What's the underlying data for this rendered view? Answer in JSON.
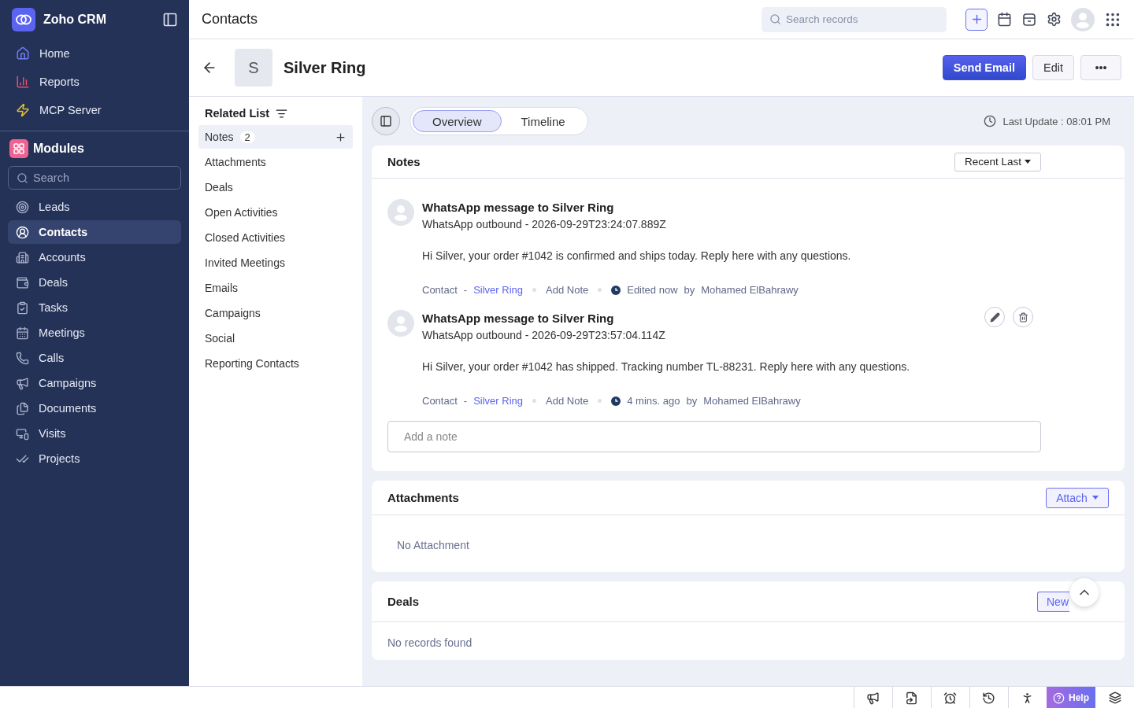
{
  "brand": {
    "name": "Zoho CRM"
  },
  "top_nav": [
    {
      "label": "Home",
      "kind": "home"
    },
    {
      "label": "Reports",
      "kind": "reports"
    },
    {
      "label": "MCP Server",
      "kind": "mcp"
    }
  ],
  "modules": {
    "title": "Modules",
    "search_placeholder": "Search",
    "items": [
      {
        "label": "Leads",
        "kind": "leads",
        "selected": false
      },
      {
        "label": "Contacts",
        "kind": "contacts",
        "selected": true
      },
      {
        "label": "Accounts",
        "kind": "accounts",
        "selected": false
      },
      {
        "label": "Deals",
        "kind": "deals",
        "selected": false
      },
      {
        "label": "Tasks",
        "kind": "tasks",
        "selected": false
      },
      {
        "label": "Meetings",
        "kind": "meetings",
        "selected": false
      },
      {
        "label": "Calls",
        "kind": "calls",
        "selected": false
      },
      {
        "label": "Campaigns",
        "kind": "campaigns",
        "selected": false
      },
      {
        "label": "Documents",
        "kind": "documents",
        "selected": false
      },
      {
        "label": "Visits",
        "kind": "visits",
        "selected": false
      },
      {
        "label": "Projects",
        "kind": "projects",
        "selected": false
      }
    ]
  },
  "page_title": "Contacts",
  "search": {
    "placeholder": "Search records"
  },
  "record": {
    "initial": "S",
    "name": "Silver Ring",
    "actions": [
      {
        "label": "Send Email",
        "kind": "primary"
      },
      {
        "label": "Edit",
        "kind": "secondary"
      },
      {
        "label": "•••",
        "kind": "secondary"
      }
    ]
  },
  "related_list": {
    "title": "Related List",
    "items": [
      {
        "label": "Notes",
        "count": "2",
        "selected": true
      },
      {
        "label": "Attachments",
        "selected": false
      },
      {
        "label": "Deals",
        "selected": false
      },
      {
        "label": "Open Activities",
        "selected": false
      },
      {
        "label": "Closed Activities",
        "selected": false
      },
      {
        "label": "Invited Meetings",
        "selected": false
      },
      {
        "label": "Emails",
        "selected": false
      },
      {
        "label": "Campaigns",
        "selected": false
      },
      {
        "label": "Social",
        "selected": false
      },
      {
        "label": "Reporting Contacts",
        "selected": false
      }
    ]
  },
  "view_tabs": [
    {
      "label": "Overview",
      "selected": true
    },
    {
      "label": "Timeline",
      "selected": false
    }
  ],
  "last_update": "Last Update : 08:01 PM",
  "notes": {
    "title": "Notes",
    "sort": "Recent Last",
    "items": [
      {
        "title": "WhatsApp message to Silver Ring",
        "subtitle": "WhatsApp outbound - 2026-09-29T23:24:07.889Z",
        "body": "Hi Silver, your order #1042 is confirmed and ships today. Reply here with any questions.",
        "module": "Contact",
        "separator": "-",
        "record": "Silver Ring",
        "source": "Add Note",
        "time": "Edited now",
        "by": "by",
        "author": "Mohamed ElBahrawy",
        "hovered": false
      },
      {
        "title": "WhatsApp message to Silver Ring",
        "subtitle": "WhatsApp outbound - 2026-09-29T23:57:04.114Z",
        "body": "Hi Silver, your order #1042 has shipped. Tracking number TL-88231. Reply here with any questions.",
        "module": "Contact",
        "separator": "-",
        "record": "Silver Ring",
        "source": "Add Note",
        "time": "4 mins. ago",
        "by": "by",
        "author": "Mohamed ElBahrawy",
        "hovered": true
      }
    ],
    "add_placeholder": "Add a note"
  },
  "attachments": {
    "title": "Attachments",
    "action": "Attach",
    "empty": "No Attachment"
  },
  "deals": {
    "title": "Deals",
    "action": "New",
    "empty": "No records found"
  },
  "help": {
    "label": "Help"
  }
}
